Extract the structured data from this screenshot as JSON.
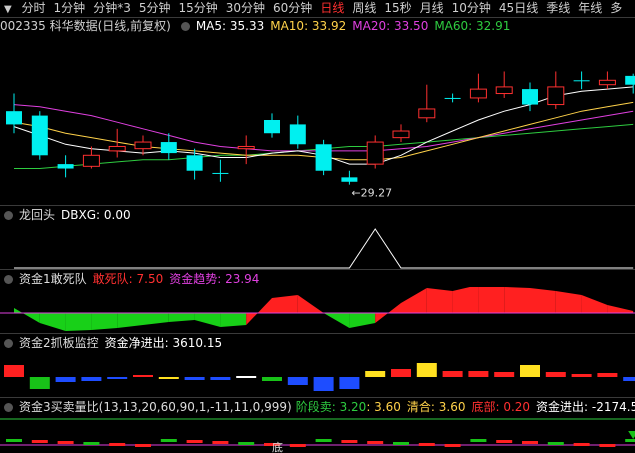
{
  "period_bar": {
    "lead_icon": "menu-triangle-icon",
    "tabs": [
      "分时",
      "1分钟",
      "分钟*3",
      "5分钟",
      "15分钟",
      "30分钟",
      "60分钟",
      "日线",
      "周线",
      "15秒",
      "月线",
      "10分钟",
      "45日线",
      "季线",
      "年线",
      "多"
    ],
    "active": "日线"
  },
  "main_header": {
    "stock": "002335 科华数据(日线,前复权)",
    "ma5": "MA5: 35.33",
    "ma10": "MA10: 33.92",
    "ma20": "MA20: 33.50",
    "ma60": "MA60: 32.91",
    "colors": {
      "ma5": "#ffffff",
      "ma10": "#ffd24a",
      "ma20": "#e040e0",
      "ma60": "#2ecc40"
    }
  },
  "chart_data": {
    "type": "candlestick",
    "low_annotation": "←29.27",
    "low_value": 29.27,
    "candles": [
      {
        "o": 32.6,
        "c": 32.0,
        "h": 33.4,
        "l": 31.6
      },
      {
        "o": 32.4,
        "c": 30.6,
        "h": 32.6,
        "l": 30.4
      },
      {
        "o": 30.2,
        "c": 30.0,
        "h": 30.6,
        "l": 29.6
      },
      {
        "o": 30.1,
        "c": 30.6,
        "h": 31.0,
        "l": 30.0
      },
      {
        "o": 30.8,
        "c": 31.0,
        "h": 31.8,
        "l": 30.5
      },
      {
        "o": 30.9,
        "c": 31.2,
        "h": 31.5,
        "l": 30.6
      },
      {
        "o": 31.2,
        "c": 30.7,
        "h": 31.6,
        "l": 30.4
      },
      {
        "o": 30.6,
        "c": 29.9,
        "h": 30.9,
        "l": 29.5
      },
      {
        "o": 29.8,
        "c": 29.8,
        "h": 30.4,
        "l": 29.4
      },
      {
        "o": 30.9,
        "c": 31.0,
        "h": 31.5,
        "l": 30.2
      },
      {
        "o": 32.2,
        "c": 31.6,
        "h": 32.5,
        "l": 31.4
      },
      {
        "o": 32.0,
        "c": 31.1,
        "h": 32.4,
        "l": 30.9
      },
      {
        "o": 31.1,
        "c": 29.9,
        "h": 31.3,
        "l": 29.7
      },
      {
        "o": 29.6,
        "c": 29.4,
        "h": 29.9,
        "l": 29.27
      },
      {
        "o": 30.2,
        "c": 31.2,
        "h": 31.5,
        "l": 30.0
      },
      {
        "o": 31.4,
        "c": 31.7,
        "h": 32.0,
        "l": 31.2
      },
      {
        "o": 32.3,
        "c": 32.7,
        "h": 33.8,
        "l": 32.1
      },
      {
        "o": 33.2,
        "c": 33.2,
        "h": 33.4,
        "l": 33.0
      },
      {
        "o": 33.2,
        "c": 33.6,
        "h": 34.3,
        "l": 33.0
      },
      {
        "o": 33.4,
        "c": 33.7,
        "h": 34.4,
        "l": 33.2
      },
      {
        "o": 33.6,
        "c": 32.9,
        "h": 33.9,
        "l": 32.6
      },
      {
        "o": 32.9,
        "c": 33.7,
        "h": 34.4,
        "l": 32.7
      },
      {
        "o": 34.0,
        "c": 34.0,
        "h": 34.4,
        "l": 33.6
      },
      {
        "o": 33.8,
        "c": 34.0,
        "h": 34.4,
        "l": 33.6
      },
      {
        "o": 34.2,
        "c": 33.8,
        "h": 34.3,
        "l": 33.4
      }
    ],
    "ma5": [
      31.9,
      31.5,
      31.1,
      30.9,
      30.8,
      30.7,
      30.8,
      30.7,
      30.5,
      30.5,
      30.7,
      30.8,
      30.6,
      30.2,
      30.2,
      30.6,
      31.2,
      31.7,
      32.2,
      32.6,
      32.9,
      33.3,
      33.5,
      33.6,
      33.7
    ],
    "ma10": [
      32.1,
      31.9,
      31.6,
      31.4,
      31.2,
      31.0,
      30.9,
      30.8,
      30.7,
      30.6,
      30.6,
      30.6,
      30.5,
      30.4,
      30.4,
      30.5,
      30.8,
      31.1,
      31.4,
      31.7,
      32.0,
      32.3,
      32.6,
      32.8,
      33.0
    ],
    "ma20": [
      32.9,
      32.8,
      32.6,
      32.4,
      32.1,
      31.8,
      31.5,
      31.2,
      31.0,
      30.9,
      30.8,
      30.8,
      30.8,
      30.8,
      30.8,
      30.9,
      31.0,
      31.2,
      31.4,
      31.6,
      31.8,
      32.0,
      32.2,
      32.4,
      32.6
    ],
    "ma60": [
      30.0,
      30.0,
      30.1,
      30.2,
      30.3,
      30.4,
      30.4,
      30.5,
      30.6,
      30.6,
      30.7,
      30.8,
      30.9,
      31.0,
      31.0,
      31.1,
      31.2,
      31.3,
      31.4,
      31.5,
      31.6,
      31.7,
      31.8,
      31.9,
      32.0
    ],
    "ylim": [
      28.8,
      35.6
    ]
  },
  "panel_dragon": {
    "title": "龙回头",
    "value": "DBXG: 0.00",
    "series": [
      0,
      0,
      0,
      0,
      0,
      0,
      0,
      0,
      0,
      0,
      0,
      0,
      0,
      0,
      1,
      0,
      0,
      0,
      0,
      0,
      0,
      0,
      0,
      0,
      0
    ]
  },
  "panel_dare": {
    "title": "资金1敢死队",
    "label1": "敢死队: 7.50",
    "label2": "资金趋势: 23.94",
    "c1": "#ff3030",
    "c2": "#e040e0",
    "values": [
      5,
      -10,
      -18,
      -17,
      -15,
      -12,
      -9,
      -7,
      -14,
      -12,
      15,
      18,
      0,
      -15,
      -10,
      10,
      25,
      22,
      28,
      26,
      25,
      22,
      18,
      8,
      2
    ]
  },
  "panel_monitor": {
    "title": "资金2抓板监控",
    "value": "资金净进出: 3610.15",
    "bars": [
      {
        "v": 12,
        "c": "#ff2020"
      },
      {
        "v": -12,
        "c": "#18c218"
      },
      {
        "v": -5,
        "c": "#1e4dff"
      },
      {
        "v": -4,
        "c": "#1e4dff"
      },
      {
        "v": -2,
        "c": "#1e4dff"
      },
      {
        "v": 2,
        "c": "#ff2020"
      },
      {
        "v": -2,
        "c": "#ffe020"
      },
      {
        "v": -3,
        "c": "#1e4dff"
      },
      {
        "v": -3,
        "c": "#1e4dff"
      },
      {
        "v": 1,
        "c": "#ffffff"
      },
      {
        "v": -4,
        "c": "#18c218"
      },
      {
        "v": -8,
        "c": "#1e4dff"
      },
      {
        "v": -14,
        "c": "#1e4dff"
      },
      {
        "v": -12,
        "c": "#1e4dff"
      },
      {
        "v": 6,
        "c": "#ffe020"
      },
      {
        "v": 8,
        "c": "#ff2020"
      },
      {
        "v": 14,
        "c": "#ffe020"
      },
      {
        "v": 6,
        "c": "#ff2020"
      },
      {
        "v": 6,
        "c": "#ff2020"
      },
      {
        "v": 5,
        "c": "#ff2020"
      },
      {
        "v": 12,
        "c": "#ffe020"
      },
      {
        "v": 5,
        "c": "#ff2020"
      },
      {
        "v": 3,
        "c": "#ff2020"
      },
      {
        "v": 4,
        "c": "#ff2020"
      },
      {
        "v": -4,
        "c": "#1e4dff"
      }
    ]
  },
  "panel_buysell": {
    "title": "资金3买卖量比(13,13,20,60,90,1,-11,11,0,999)",
    "stage_sell": "阶段卖: 3.20",
    "stage_sell2": ": 3.60",
    "clear": "清合: 3.60",
    "bottom": "底部: 0.20",
    "flow": "资金进出: -2174.58",
    "c_stage": "#2ecc40",
    "c_num": "#ffd24a",
    "c_bottom": "#ff3030",
    "bottom_mark": "底"
  }
}
